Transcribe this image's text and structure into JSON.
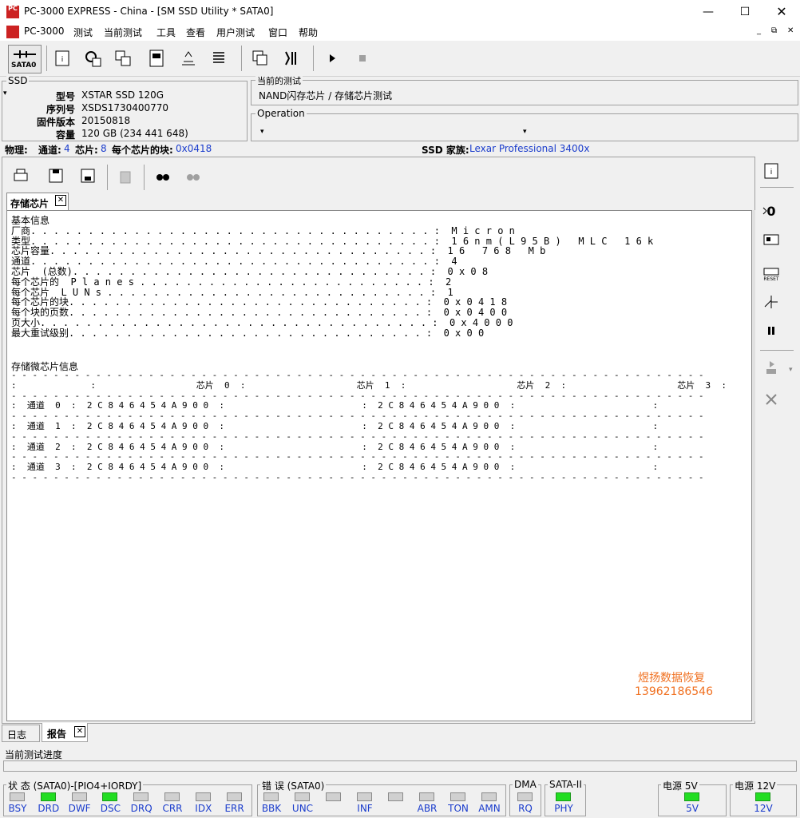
{
  "window": {
    "title": "PC-3000 EXPRESS - China - [SM SSD Utility * SATA0]",
    "app_icon_text": "PC"
  },
  "menu": [
    "PC-3000",
    "测试",
    "当前测试",
    "工具",
    "查看",
    "用户测试",
    "窗口",
    "帮助"
  ],
  "toolbar": {
    "sata_label": "SATA0"
  },
  "ssd": {
    "group_label": "SSD",
    "rows": [
      {
        "label": "型号",
        "value": "XSTAR SSD 120G"
      },
      {
        "label": "序列号",
        "value": "XSDS1730400770"
      },
      {
        "label": "固件版本",
        "value": "20150818"
      },
      {
        "label": "容量",
        "value": "120 GB (234 441 648)"
      }
    ]
  },
  "current_test": {
    "group_label": "当前的测试",
    "value": "NAND闪存芯片 / 存储芯片测试"
  },
  "operation": {
    "group_label": "Operation"
  },
  "physical": {
    "label": "物理:",
    "channels_label": "通道:",
    "channels_value": "4",
    "chips_label": "芯片:",
    "chips_value": "8",
    "blocks_label": "每个芯片的块:",
    "blocks_value": "0x0418",
    "family_label": "SSD 家族:",
    "family_value": "Lexar Professional 3400x"
  },
  "tab": {
    "label": "存储芯片",
    "close": "✕"
  },
  "report_lines": [
    "基本信息",
    "厂商. . . . . . . . . . . . . . . . . . . . . . . . . . . . . . . . . . . :  M i c r o n",
    "类型. . . . . . . . . . . . . . . . . . . . . . . . . . . . . . . . . . . :  1 6 n m ( L 9 5 B )   M L C   1 6 k",
    "芯片容量. . . . . . . . . . . . . . . . . . . . . . . . . . . . . . . . . :  1 6   7 6 8   M b",
    "通道. . . . . . . . . . . . . . . . . . . . . . . . . . . . . . . . . . . :  4",
    "芯片  (总数). . . . . . . . . . . . . . . . . . . . . . . . . . . . . . . :  0 x 0 8",
    "每个芯片的  P l a n e s . . . . . . . . . . . . . . . . . . . . . . . . . :  2",
    "每个芯片  L U N s . . . . . . . . . . . . . . . . . . . . . . . . . . . . :  1",
    "每个芯片的块. . . . . . . . . . . . . . . . . . . . . . . . . . . . . . . :  0 x 0 4 1 8",
    "每个块的页数. . . . . . . . . . . . . . . . . . . . . . . . . . . . . . . :  0 x 0 4 0 0",
    "页大小. . . . . . . . . . . . . . . . . . . . . . . . . . . . . . . . . . :  0 x 4 0 0 0",
    "最大重试级别. . . . . . . . . . . . . . . . . . . . . . . . . . . . . . . :  0 x 0 0"
  ],
  "chip_section_title": "存储微芯片信息",
  "chip_table_lines": [
    "- - - - - - - - - - - - - - - - - - - - - - - - - - - - - - - - - - - - - - - - - - - - - - - - - - - - - - - - - - - - - - - - - -",
    ":              :                   芯片  0  :                     芯片  1  :                     芯片  2  :                     芯片  3  :",
    "- - - - - - - - - - - - - - - - - - - - - - - - - - - - - - - - - - - - - - - - - - - - - - - - - - - - - - - - - - - - - - - - - -",
    ":  通道  0  :  2 C 8 4 6 4 5 4 A 9 0 0  :                          :  2 C 8 4 6 4 5 4 A 9 0 0  :                          :",
    "- - - - - - - - - - - - - - - - - - - - - - - - - - - - - - - - - - - - - - - - - - - - - - - - - - - - - - - - - - - - - - - - - -",
    ":  通道  1  :  2 C 8 4 6 4 5 4 A 9 0 0  :                          :  2 C 8 4 6 4 5 4 A 9 0 0  :                          :",
    "- - - - - - - - - - - - - - - - - - - - - - - - - - - - - - - - - - - - - - - - - - - - - - - - - - - - - - - - - - - - - - - - - -",
    ":  通道  2  :  2 C 8 4 6 4 5 4 A 9 0 0  :                          :  2 C 8 4 6 4 5 4 A 9 0 0  :                          :",
    "- - - - - - - - - - - - - - - - - - - - - - - - - - - - - - - - - - - - - - - - - - - - - - - - - - - - - - - - - - - - - - - - - -",
    ":  通道  3  :  2 C 8 4 6 4 5 4 A 9 0 0  :                          :  2 C 8 4 6 4 5 4 A 9 0 0  :                          :",
    "- - - - - - - - - - - - - - - - - - - - - - - - - - - - - - - - - - - - - - - - - - - - - - - - - - - - - - - - - - - - - - - - - -"
  ],
  "watermark": {
    "line1": "煜扬数据恢复",
    "line2": "13962186546",
    "color": "#f07020"
  },
  "bottom_tabs": [
    {
      "label": "日志"
    },
    {
      "label": "报告",
      "close": "✕"
    }
  ],
  "progress_label": "当前测试进度",
  "status": {
    "group_label": "状 态 (SATA0)-[PIO4+IORDY]",
    "leds": [
      {
        "label": "BSY",
        "on": false
      },
      {
        "label": "DRD",
        "on": true
      },
      {
        "label": "DWF",
        "on": false
      },
      {
        "label": "DSC",
        "on": true
      },
      {
        "label": "DRQ",
        "on": false
      },
      {
        "label": "CRR",
        "on": false
      },
      {
        "label": "IDX",
        "on": false
      },
      {
        "label": "ERR",
        "on": false
      }
    ]
  },
  "errors": {
    "group_label": "错 误 (SATA0)",
    "leds": [
      {
        "label": "BBK",
        "on": false
      },
      {
        "label": "UNC",
        "on": false
      },
      {
        "label": "",
        "on": false
      },
      {
        "label": "INF",
        "on": false
      },
      {
        "label": "",
        "on": false
      },
      {
        "label": "ABR",
        "on": false
      },
      {
        "label": "TON",
        "on": false
      },
      {
        "label": "AMN",
        "on": false
      }
    ]
  },
  "dma": {
    "group_label": "DMA",
    "led_label": "RQ",
    "on": false
  },
  "sata": {
    "group_label": "SATA-II",
    "led_label": "PHY",
    "on": true
  },
  "power5": {
    "group_label": "电源 5V",
    "led_label": "5V",
    "on": true
  },
  "power12": {
    "group_label": "电源 12V",
    "led_label": "12V",
    "on": true
  },
  "colors": {
    "led_on": "#22dd22",
    "led_off": "#d0d0d0",
    "link_blue": "#1a3ccc"
  }
}
